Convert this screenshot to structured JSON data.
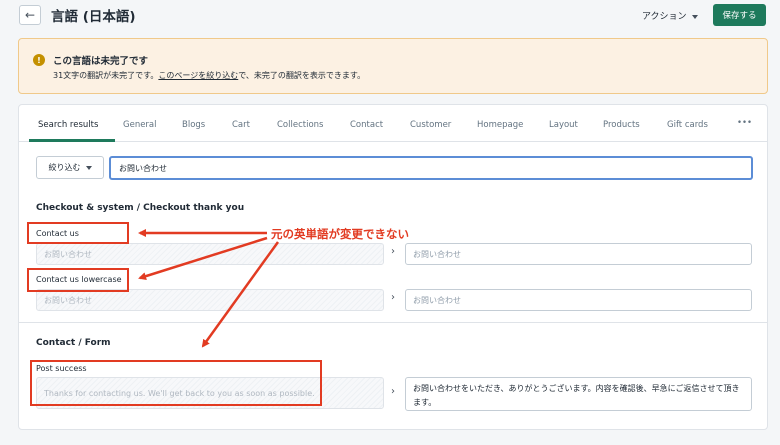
{
  "header": {
    "back_icon": "arrow-left-icon",
    "title": "言語 (日本語)",
    "action_label": "アクション",
    "save_label": "保存する"
  },
  "banner": {
    "icon": "exclamation-icon",
    "title": "この言語は未完了です",
    "desc_pre": "31文字の翻訳が未完了です。",
    "desc_link": "このページを絞り込む",
    "desc_post": "で、未完了の翻訳を表示できます。"
  },
  "tabs": [
    "Search results",
    "General",
    "Blogs",
    "Cart",
    "Collections",
    "Contact",
    "Customer",
    "Homepage",
    "Layout",
    "Products",
    "Gift cards",
    "•••"
  ],
  "filter": {
    "button_label": "絞り込む",
    "search_value": "お問い合わせ"
  },
  "sections": [
    {
      "title": "Checkout & system / Checkout thank you",
      "fields": [
        {
          "label": "Contact us",
          "source": "お問い合わせ",
          "target": "お問い合わせ"
        },
        {
          "label": "Contact us lowercase",
          "source": "お問い合わせ",
          "target": "お問い合わせ"
        }
      ]
    },
    {
      "title": "Contact / Form",
      "fields": [
        {
          "label": "Post success",
          "source": "Thanks for contacting us. We'll get back to you as soon as possible.",
          "target": "お問い合わせをいただき、ありがとうございます。内容を確認後、早急にご返信させて頂きます。"
        }
      ]
    }
  ],
  "annotation": {
    "text": "元の英単語が変更できない",
    "color": "#e23b22"
  },
  "colors": {
    "primary": "#1e7a5c",
    "banner_bg": "#fcf1e3",
    "focus": "#5c8dd6"
  }
}
